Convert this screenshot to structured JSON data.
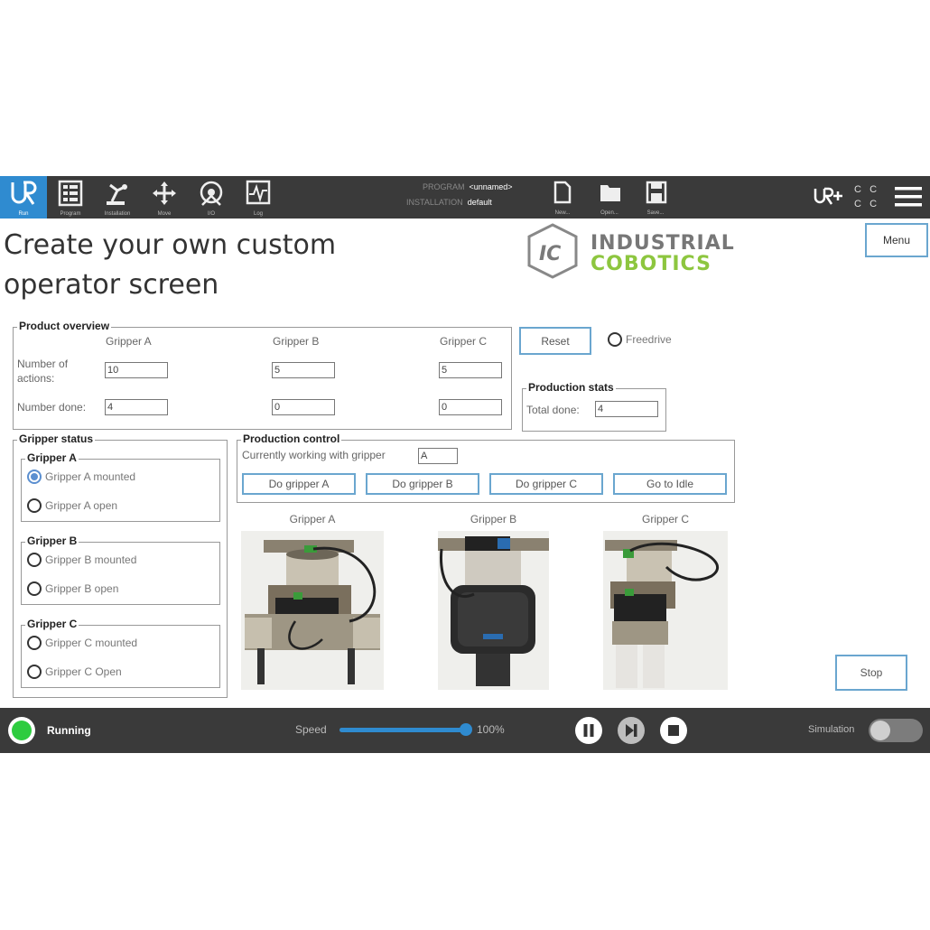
{
  "topbar": {
    "nav": [
      {
        "label": "Run",
        "icon": "ur-logo-icon"
      },
      {
        "label": "Program",
        "icon": "program-icon"
      },
      {
        "label": "Installation",
        "icon": "installation-icon"
      },
      {
        "label": "Move",
        "icon": "move-icon"
      },
      {
        "label": "I/O",
        "icon": "io-icon"
      },
      {
        "label": "Log",
        "icon": "log-icon"
      }
    ],
    "program_label": "PROGRAM",
    "program_value": "<unnamed>",
    "installation_label": "INSTALLATION",
    "installation_value": "default",
    "files": [
      {
        "label": "New...",
        "icon": "new-file-icon"
      },
      {
        "label": "Open...",
        "icon": "open-folder-icon"
      },
      {
        "label": "Save...",
        "icon": "save-icon"
      }
    ],
    "cc": [
      "C",
      "C",
      "C",
      "C"
    ]
  },
  "header": {
    "title_line1": "Create your own custom",
    "title_line2": "operator screen",
    "menu_label": "Menu",
    "logo_mark": "IC",
    "logo_line1": "INDUSTRIAL",
    "logo_line2": "COBOTICS"
  },
  "product_overview": {
    "legend": "Product overview",
    "columns": [
      "Gripper A",
      "Gripper B",
      "Gripper C"
    ],
    "row_actions_label_1": "Number of",
    "row_actions_label_2": "actions:",
    "row_done_label": "Number done:",
    "actions": [
      "10",
      "5",
      "5"
    ],
    "done": [
      "4",
      "0",
      "0"
    ]
  },
  "controls": {
    "reset_label": "Reset",
    "freedrive_label": "Freedrive"
  },
  "production_stats": {
    "legend": "Production stats",
    "total_label": "Total done:",
    "total_value": "4"
  },
  "gripper_status": {
    "legend": "Gripper status",
    "groups": [
      {
        "title": "Gripper A",
        "opt1": "Gripper A mounted",
        "opt2": "Gripper A open",
        "selected": 1
      },
      {
        "title": "Gripper B",
        "opt1": "Gripper B mounted",
        "opt2": "Gripper B open",
        "selected": 0
      },
      {
        "title": "Gripper C",
        "opt1": "Gripper C mounted",
        "opt2": "Gripper C Open",
        "selected": 0
      }
    ]
  },
  "production_control": {
    "legend": "Production control",
    "current_label": "Currently working with gripper",
    "current_value": "A",
    "buttons": [
      "Do gripper A",
      "Do gripper B",
      "Do gripper C",
      "Go to Idle"
    ]
  },
  "photos": {
    "captions": [
      "Gripper A",
      "Gripper B",
      "Gripper C"
    ]
  },
  "stop_label": "Stop",
  "bottombar": {
    "status": "Running",
    "status_color": "#2ecc40",
    "speed_label": "Speed",
    "speed_value": "100%",
    "speed_fraction": 1.0,
    "simulation_label": "Simulation",
    "accent": "#2f8bd0"
  }
}
